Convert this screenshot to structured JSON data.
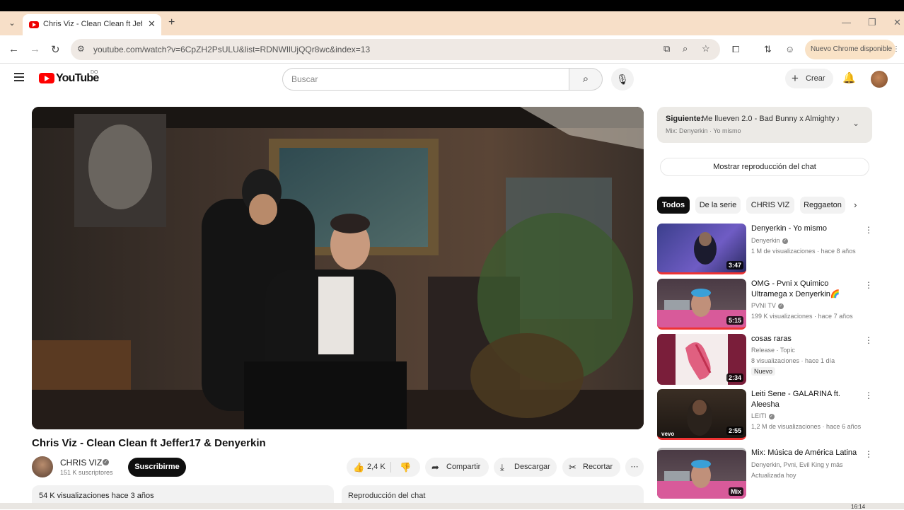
{
  "browser": {
    "tab_title": "Chris Viz - Clean Clean ft Jeffer",
    "tab_close": "✕",
    "new_tab": "+",
    "url": "youtube.com/watch?v=6CpZH2PsULU&list=RDNWIlUjQQr8wc&index=13",
    "chrome_update": "Nuevo Chrome disponible",
    "window": {
      "minimize": "—",
      "maximize": "❐",
      "close": "✕"
    }
  },
  "youtube": {
    "logo_text": "YouTube",
    "logo_country": "DO",
    "search_placeholder": "Buscar",
    "create_label": "Crear"
  },
  "video": {
    "title": "Chris Viz - Clean Clean ft Jeffer17 & Denyerkin",
    "channel": "CHRIS VIZ",
    "subscribers": "151 K suscriptores",
    "subscribe_label": "Suscribirme",
    "likes": "2,4 K",
    "share_label": "Compartir",
    "download_label": "Descargar",
    "clip_label": "Recortar",
    "more": "⋯",
    "views_date": "54 K visualizaciones  hace 3 años",
    "chat_replay": "Reproducción del chat"
  },
  "sidebar": {
    "next_label": "Siguiente:",
    "next_title": "Me llueven 2.0 - Bad Bunny x Almighty x ...",
    "next_sub": "Mix: Denyerkin · Yo mismo",
    "show_chat": "Mostrar reproducción del chat",
    "chips": [
      "Todos",
      "De la serie",
      "CHRIS VIZ",
      "Reggaeton"
    ],
    "recommendations": [
      {
        "title": "Denyerkin - Yo mismo",
        "channel": "Denyerkin",
        "verified": true,
        "meta": "1 M de visualizaciones · hace 8 años",
        "duration": "3:47",
        "badge": ""
      },
      {
        "title": "OMG - Pvni x Quimico Ultramega x Denyerkin🌈 (Tra...",
        "channel": "PVNI TV",
        "verified": true,
        "meta": "199 K visualizaciones · hace 7 años",
        "duration": "5:15",
        "badge": ""
      },
      {
        "title": "cosas raras",
        "channel": "Release · Topic",
        "verified": false,
        "meta": "8 visualizaciones · hace 1 día",
        "duration": "2:34",
        "badge": "Nuevo"
      },
      {
        "title": "Leiti Sene - GALARINA ft. Aleesha",
        "channel": "LEITI",
        "verified": true,
        "meta": "1,2 M de visualizaciones · hace 6 años",
        "duration": "2:55",
        "badge": ""
      },
      {
        "title": "Mix: Música de América Latina",
        "channel": "Denyerkin, Pvni, Evil King y más",
        "verified": false,
        "meta": "Actualizada hoy",
        "duration": "Mix",
        "badge": ""
      }
    ]
  },
  "taskbar": {
    "time": "16:14"
  },
  "colors": {
    "brand_red": "#ff0000",
    "tab_bar": "#f7dfc8",
    "chrome_pill": "#f9e2c6",
    "chip_active": "#0f0f0f"
  }
}
